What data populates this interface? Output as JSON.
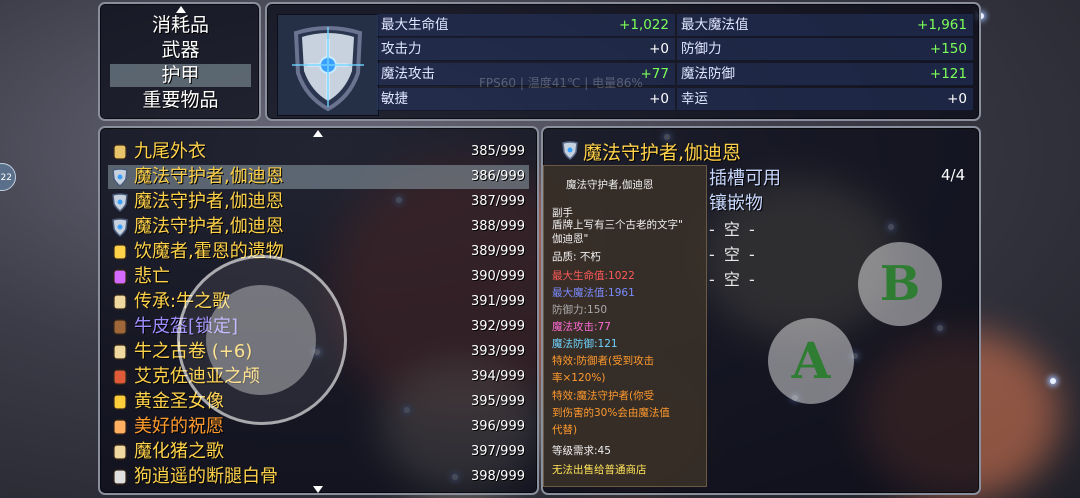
{
  "categories": {
    "items": [
      "消耗品",
      "武器",
      "护甲",
      "重要物品"
    ],
    "selected_index": 2
  },
  "stats": {
    "left": [
      {
        "label": "最大生命值",
        "value": "+1,022",
        "positive": true
      },
      {
        "label": "攻击力",
        "value": "+0",
        "positive": false
      },
      {
        "label": "魔法攻击",
        "value": "+77",
        "positive": true
      },
      {
        "label": "敏捷",
        "value": "+0",
        "positive": false
      }
    ],
    "right": [
      {
        "label": "最大魔法值",
        "value": "+1,961",
        "positive": true
      },
      {
        "label": "防御力",
        "value": "+150",
        "positive": true
      },
      {
        "label": "魔法防御",
        "value": "+121",
        "positive": true
      },
      {
        "label": "幸运",
        "value": "+0",
        "positive": false
      }
    ],
    "overlay": "FPS60 | 温度41℃ | 电量86%"
  },
  "items": [
    {
      "name": "九尾外衣",
      "count": "385/999",
      "color": "#ffd24a",
      "icon": "cloak-icon"
    },
    {
      "name": "魔法守护者,伽迪恩",
      "count": "386/999",
      "color": "#ffd24a",
      "icon": "shield-icon"
    },
    {
      "name": "魔法守护者,伽迪恩",
      "count": "387/999",
      "color": "#ffd24a",
      "icon": "shield-icon"
    },
    {
      "name": "魔法守护者,伽迪恩",
      "count": "388/999",
      "color": "#ffd24a",
      "icon": "shield-icon"
    },
    {
      "name": "饮魔者,霍恩的遗物",
      "count": "389/999",
      "color": "#ffd24a",
      "icon": "relic-icon"
    },
    {
      "name": "悲亡",
      "count": "390/999",
      "color": "#ffd24a",
      "icon": "ring-icon"
    },
    {
      "name": "传承:牛之歌",
      "count": "391/999",
      "color": "#ffd24a",
      "icon": "scroll-icon"
    },
    {
      "name": "牛皮盔[锁定]",
      "count": "392/999",
      "color": "#9e8cff",
      "icon": "helmet-icon"
    },
    {
      "name": "牛之古卷 (+6)",
      "count": "393/999",
      "color": "#ffd24a",
      "icon": "scroll-icon"
    },
    {
      "name": "艾克佐迪亚之颅",
      "count": "394/999",
      "color": "#ffd24a",
      "icon": "skull-icon"
    },
    {
      "name": "黄金圣女像",
      "count": "395/999",
      "color": "#ffd24a",
      "icon": "statue-icon"
    },
    {
      "name": "美好的祝愿",
      "count": "396/999",
      "color": "#ff9a2e",
      "icon": "cloud-icon"
    },
    {
      "name": "魔化猪之歌",
      "count": "397/999",
      "color": "#ffd24a",
      "icon": "scroll-icon"
    },
    {
      "name": "狗逍遥的断腿白骨",
      "count": "398/999",
      "color": "#ffd24a",
      "icon": "bone-icon"
    }
  ],
  "list_selected_index": 1,
  "detail": {
    "title": "魔法守护者,伽迪恩",
    "slot_label": "插槽可用",
    "slot_count": "4/4",
    "inlay_label": "镶嵌物",
    "empty_slots": [
      "- 空 -",
      "- 空 -",
      "- 空 -"
    ]
  },
  "tooltip": [
    {
      "text": "魔法守护者,伽迪恩",
      "cls": "tt-white",
      "indent": 14
    },
    {
      "text": "副手",
      "cls": "tt-white",
      "indent": 0
    },
    {
      "text": "盾牌上写有三个古老的文字\"",
      "cls": "tt-white",
      "indent": 0
    },
    {
      "text": "伽迪恩\"",
      "cls": "tt-white",
      "indent": 0
    },
    {
      "text": "品质: 不朽",
      "cls": "tt-white",
      "indent": 0
    },
    {
      "text": "最大生命值:1022",
      "cls": "tt-red",
      "indent": 0
    },
    {
      "text": "最大魔法值:1961",
      "cls": "tt-blue",
      "indent": 0
    },
    {
      "text": "防御力:150",
      "cls": "tt-grey",
      "indent": 0
    },
    {
      "text": "魔法攻击:77",
      "cls": "tt-pink",
      "indent": 0
    },
    {
      "text": "魔法防御:121",
      "cls": "tt-cyan",
      "indent": 0
    },
    {
      "text": "特效:防御者(受到攻击",
      "cls": "tt-orange",
      "indent": 0
    },
    {
      "text": "率×120%)",
      "cls": "tt-orange",
      "indent": 0
    },
    {
      "text": "特效:魔法守护者(你受",
      "cls": "tt-orange",
      "indent": 0
    },
    {
      "text": "到伤害的30%会由魔法值",
      "cls": "tt-orange",
      "indent": 0
    },
    {
      "text": "代替)",
      "cls": "tt-orange",
      "indent": 0
    },
    {
      "text": "等级需求:45",
      "cls": "tt-white",
      "indent": 0
    },
    {
      "text": "无法出售给普通商店",
      "cls": "tt-yellow",
      "indent": 0
    }
  ],
  "controls": {
    "a_label": "A",
    "b_label": "B",
    "edge_badge": "22"
  }
}
